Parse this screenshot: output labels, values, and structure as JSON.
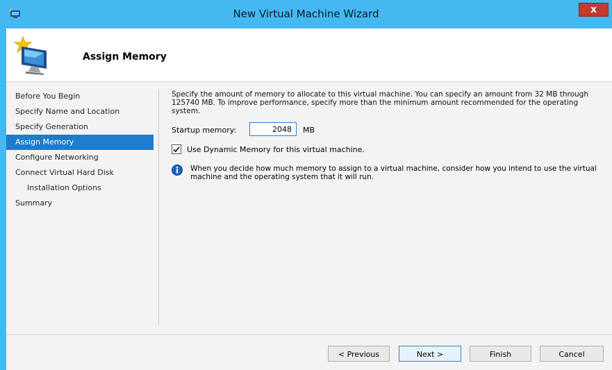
{
  "window": {
    "title": "New Virtual Machine Wizard",
    "close_glyph": "x"
  },
  "header": {
    "heading": "Assign Memory",
    "icon": "virtual-machine-wizard-icon"
  },
  "steps": [
    {
      "label": "Before You Begin",
      "active": false,
      "sub": false
    },
    {
      "label": "Specify Name and Location",
      "active": false,
      "sub": false
    },
    {
      "label": "Specify Generation",
      "active": false,
      "sub": false
    },
    {
      "label": "Assign Memory",
      "active": true,
      "sub": false
    },
    {
      "label": "Configure Networking",
      "active": false,
      "sub": false
    },
    {
      "label": "Connect Virtual Hard Disk",
      "active": false,
      "sub": false
    },
    {
      "label": "Installation Options",
      "active": false,
      "sub": true
    },
    {
      "label": "Summary",
      "active": false,
      "sub": false
    }
  ],
  "main": {
    "description": "Specify the amount of memory to allocate to this virtual machine. You can specify an amount from 32 MB through 125740 MB. To improve performance, specify more than the minimum amount recommended for the operating system.",
    "startup_memory_label": "Startup memory:",
    "startup_memory_value": "2048",
    "startup_memory_unit": "MB",
    "dynamic_memory_label": "Use Dynamic Memory for this virtual machine.",
    "dynamic_memory_checked": true,
    "info_text": "When you decide how much memory to assign to a virtual machine, consider how you intend to use the virtual machine and the operating system that it will run."
  },
  "buttons": {
    "previous": "< Previous",
    "next": "Next >",
    "finish": "Finish",
    "cancel": "Cancel"
  },
  "colors": {
    "title_bar": "#44b9f1",
    "selected_step": "#1e7ccc",
    "close_button": "#c43a2e"
  }
}
